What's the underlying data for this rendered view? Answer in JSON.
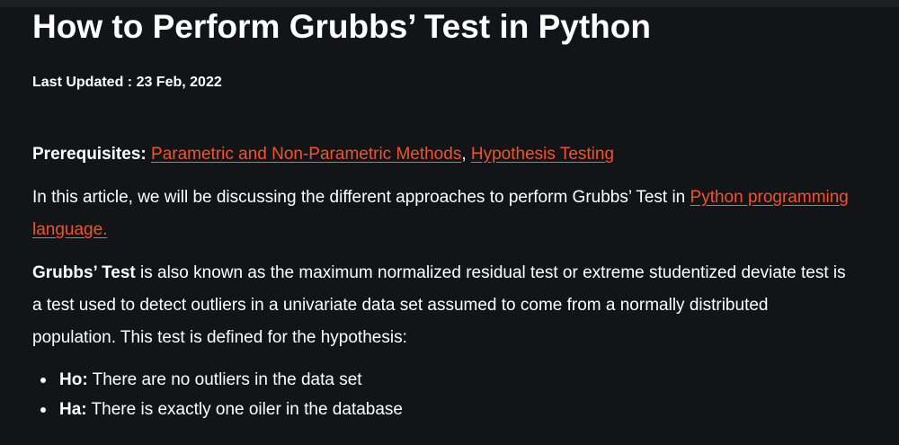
{
  "article": {
    "title": "How to Perform Grubbs’ Test in Python",
    "last_updated": "Last Updated : 23 Feb, 2022",
    "prerequisites": {
      "label": "Prerequisites:",
      "links": [
        "Parametric and Non-Parametric Methods",
        "Hypothesis Testing"
      ],
      "separator": ", "
    },
    "intro": {
      "text": "In this article, we will be discussing the different approaches to perform Grubbs’ Test in ",
      "link": "Python programming language."
    },
    "grubbs": {
      "term": "Grubbs’ Test",
      "text": " is also known as the maximum normalized residual test or extreme studentized deviate test is a test used to detect outliers in a univariate data set assumed to come from a normally distributed population. This test is defined for the hypothesis:"
    },
    "hypotheses": [
      {
        "label": "Ho:",
        "text": " There are no outliers in the data set"
      },
      {
        "label": "Ha:",
        "text": " There is exactly one oiler in the database"
      }
    ]
  },
  "colors": {
    "background": "#131417",
    "text": "#ffffff",
    "link": "#f0532d"
  }
}
